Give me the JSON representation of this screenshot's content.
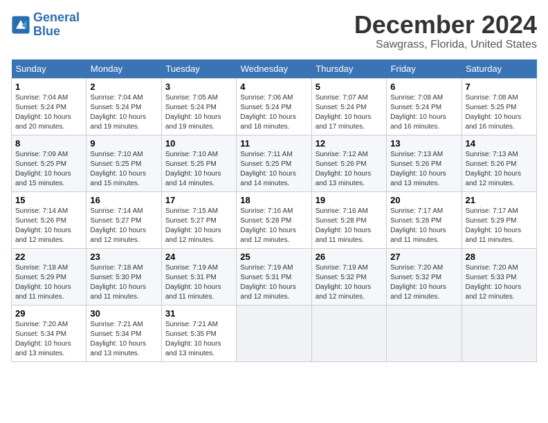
{
  "header": {
    "logo_line1": "General",
    "logo_line2": "Blue",
    "title": "December 2024",
    "subtitle": "Sawgrass, Florida, United States"
  },
  "days_of_week": [
    "Sunday",
    "Monday",
    "Tuesday",
    "Wednesday",
    "Thursday",
    "Friday",
    "Saturday"
  ],
  "weeks": [
    [
      {
        "day": "1",
        "sunrise": "7:04 AM",
        "sunset": "5:24 PM",
        "daylight": "10 hours and 20 minutes."
      },
      {
        "day": "2",
        "sunrise": "7:04 AM",
        "sunset": "5:24 PM",
        "daylight": "10 hours and 19 minutes."
      },
      {
        "day": "3",
        "sunrise": "7:05 AM",
        "sunset": "5:24 PM",
        "daylight": "10 hours and 19 minutes."
      },
      {
        "day": "4",
        "sunrise": "7:06 AM",
        "sunset": "5:24 PM",
        "daylight": "10 hours and 18 minutes."
      },
      {
        "day": "5",
        "sunrise": "7:07 AM",
        "sunset": "5:24 PM",
        "daylight": "10 hours and 17 minutes."
      },
      {
        "day": "6",
        "sunrise": "7:08 AM",
        "sunset": "5:24 PM",
        "daylight": "10 hours and 16 minutes."
      },
      {
        "day": "7",
        "sunrise": "7:08 AM",
        "sunset": "5:25 PM",
        "daylight": "10 hours and 16 minutes."
      }
    ],
    [
      {
        "day": "8",
        "sunrise": "7:09 AM",
        "sunset": "5:25 PM",
        "daylight": "10 hours and 15 minutes."
      },
      {
        "day": "9",
        "sunrise": "7:10 AM",
        "sunset": "5:25 PM",
        "daylight": "10 hours and 15 minutes."
      },
      {
        "day": "10",
        "sunrise": "7:10 AM",
        "sunset": "5:25 PM",
        "daylight": "10 hours and 14 minutes."
      },
      {
        "day": "11",
        "sunrise": "7:11 AM",
        "sunset": "5:25 PM",
        "daylight": "10 hours and 14 minutes."
      },
      {
        "day": "12",
        "sunrise": "7:12 AM",
        "sunset": "5:26 PM",
        "daylight": "10 hours and 13 minutes."
      },
      {
        "day": "13",
        "sunrise": "7:13 AM",
        "sunset": "5:26 PM",
        "daylight": "10 hours and 13 minutes."
      },
      {
        "day": "14",
        "sunrise": "7:13 AM",
        "sunset": "5:26 PM",
        "daylight": "10 hours and 12 minutes."
      }
    ],
    [
      {
        "day": "15",
        "sunrise": "7:14 AM",
        "sunset": "5:26 PM",
        "daylight": "10 hours and 12 minutes."
      },
      {
        "day": "16",
        "sunrise": "7:14 AM",
        "sunset": "5:27 PM",
        "daylight": "10 hours and 12 minutes."
      },
      {
        "day": "17",
        "sunrise": "7:15 AM",
        "sunset": "5:27 PM",
        "daylight": "10 hours and 12 minutes."
      },
      {
        "day": "18",
        "sunrise": "7:16 AM",
        "sunset": "5:28 PM",
        "daylight": "10 hours and 12 minutes."
      },
      {
        "day": "19",
        "sunrise": "7:16 AM",
        "sunset": "5:28 PM",
        "daylight": "10 hours and 11 minutes."
      },
      {
        "day": "20",
        "sunrise": "7:17 AM",
        "sunset": "5:28 PM",
        "daylight": "10 hours and 11 minutes."
      },
      {
        "day": "21",
        "sunrise": "7:17 AM",
        "sunset": "5:29 PM",
        "daylight": "10 hours and 11 minutes."
      }
    ],
    [
      {
        "day": "22",
        "sunrise": "7:18 AM",
        "sunset": "5:29 PM",
        "daylight": "10 hours and 11 minutes."
      },
      {
        "day": "23",
        "sunrise": "7:18 AM",
        "sunset": "5:30 PM",
        "daylight": "10 hours and 11 minutes."
      },
      {
        "day": "24",
        "sunrise": "7:19 AM",
        "sunset": "5:31 PM",
        "daylight": "10 hours and 11 minutes."
      },
      {
        "day": "25",
        "sunrise": "7:19 AM",
        "sunset": "5:31 PM",
        "daylight": "10 hours and 12 minutes."
      },
      {
        "day": "26",
        "sunrise": "7:19 AM",
        "sunset": "5:32 PM",
        "daylight": "10 hours and 12 minutes."
      },
      {
        "day": "27",
        "sunrise": "7:20 AM",
        "sunset": "5:32 PM",
        "daylight": "10 hours and 12 minutes."
      },
      {
        "day": "28",
        "sunrise": "7:20 AM",
        "sunset": "5:33 PM",
        "daylight": "10 hours and 12 minutes."
      }
    ],
    [
      {
        "day": "29",
        "sunrise": "7:20 AM",
        "sunset": "5:34 PM",
        "daylight": "10 hours and 13 minutes."
      },
      {
        "day": "30",
        "sunrise": "7:21 AM",
        "sunset": "5:34 PM",
        "daylight": "10 hours and 13 minutes."
      },
      {
        "day": "31",
        "sunrise": "7:21 AM",
        "sunset": "5:35 PM",
        "daylight": "10 hours and 13 minutes."
      },
      null,
      null,
      null,
      null
    ]
  ],
  "labels": {
    "sunrise": "Sunrise:",
    "sunset": "Sunset:",
    "daylight": "Daylight:"
  }
}
